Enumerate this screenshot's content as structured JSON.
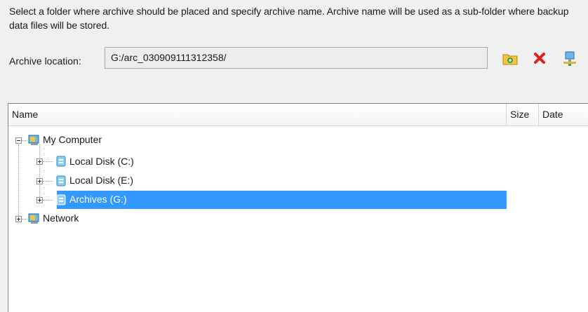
{
  "instruction": "Select a folder where archive should be placed and specify archive name. Archive name will be used as a sub-folder where backup data files will be stored.",
  "archive_location": {
    "label": "Archive location:",
    "value": "G:/arc_030909111312358/"
  },
  "toolbar": {
    "buttons": [
      {
        "icon": "new-folder-icon"
      },
      {
        "icon": "delete-icon"
      },
      {
        "icon": "network-drive-icon"
      }
    ]
  },
  "columns": [
    "Name",
    "Size",
    "Date"
  ],
  "tree": {
    "root": {
      "label": "My Computer",
      "icon": "computer-icon",
      "expanded": true
    },
    "children": [
      {
        "label": "Local Disk (C:)",
        "icon": "drive-icon"
      },
      {
        "label": "Local Disk (E:)",
        "icon": "drive-icon"
      },
      {
        "label": "Archives (G:)",
        "icon": "drive-icon",
        "selected": true
      }
    ],
    "network": {
      "label": "Network",
      "icon": "network-icon",
      "expanded": false
    }
  },
  "colors": {
    "selection": "#3399ff",
    "background": "#f0f0f0"
  }
}
